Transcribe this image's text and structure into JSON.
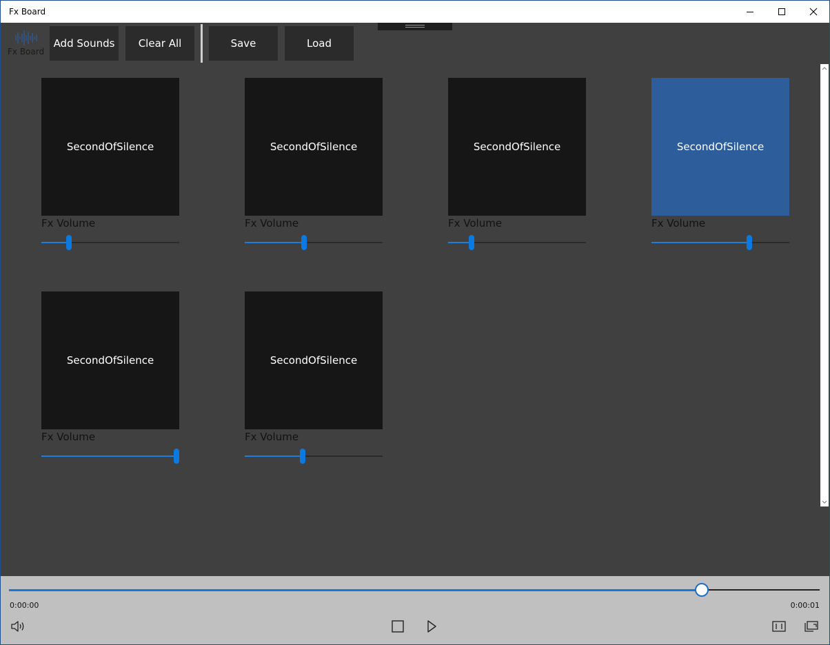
{
  "window": {
    "title": "Fx Board",
    "controls": [
      "minimize-icon",
      "maximize-icon",
      "close-icon"
    ]
  },
  "toolbar": {
    "logo_text": "Fx Board",
    "add_sounds": "Add Sounds",
    "clear_all": "Clear All",
    "save": "Save",
    "load": "Load"
  },
  "sounds": [
    {
      "name": "SecondOfSilence",
      "volume_label": "Fx Volume",
      "volume": 0.2,
      "selected": false
    },
    {
      "name": "SecondOfSilence",
      "volume_label": "Fx Volume",
      "volume": 0.43,
      "selected": false
    },
    {
      "name": "SecondOfSilence",
      "volume_label": "Fx Volume",
      "volume": 0.17,
      "selected": false
    },
    {
      "name": "SecondOfSilence",
      "volume_label": "Fx Volume",
      "volume": 0.71,
      "selected": true
    },
    {
      "name": "SecondOfSilence",
      "volume_label": "Fx Volume",
      "volume": 0.98,
      "selected": false
    },
    {
      "name": "SecondOfSilence",
      "volume_label": "Fx Volume",
      "volume": 0.42,
      "selected": false
    }
  ],
  "player": {
    "current_time": "0:00:00",
    "total_time": "0:00:01",
    "progress": 0.855,
    "icons": [
      "volume-icon",
      "stop-icon",
      "play-icon",
      "aspect-ratio-icon",
      "cast-icon"
    ]
  },
  "colors": {
    "accent": "#0a7ae0",
    "selected_tile": "#2e5d9c",
    "tile": "#161616",
    "background": "#404040",
    "player_bar": "#c0c0c0"
  }
}
